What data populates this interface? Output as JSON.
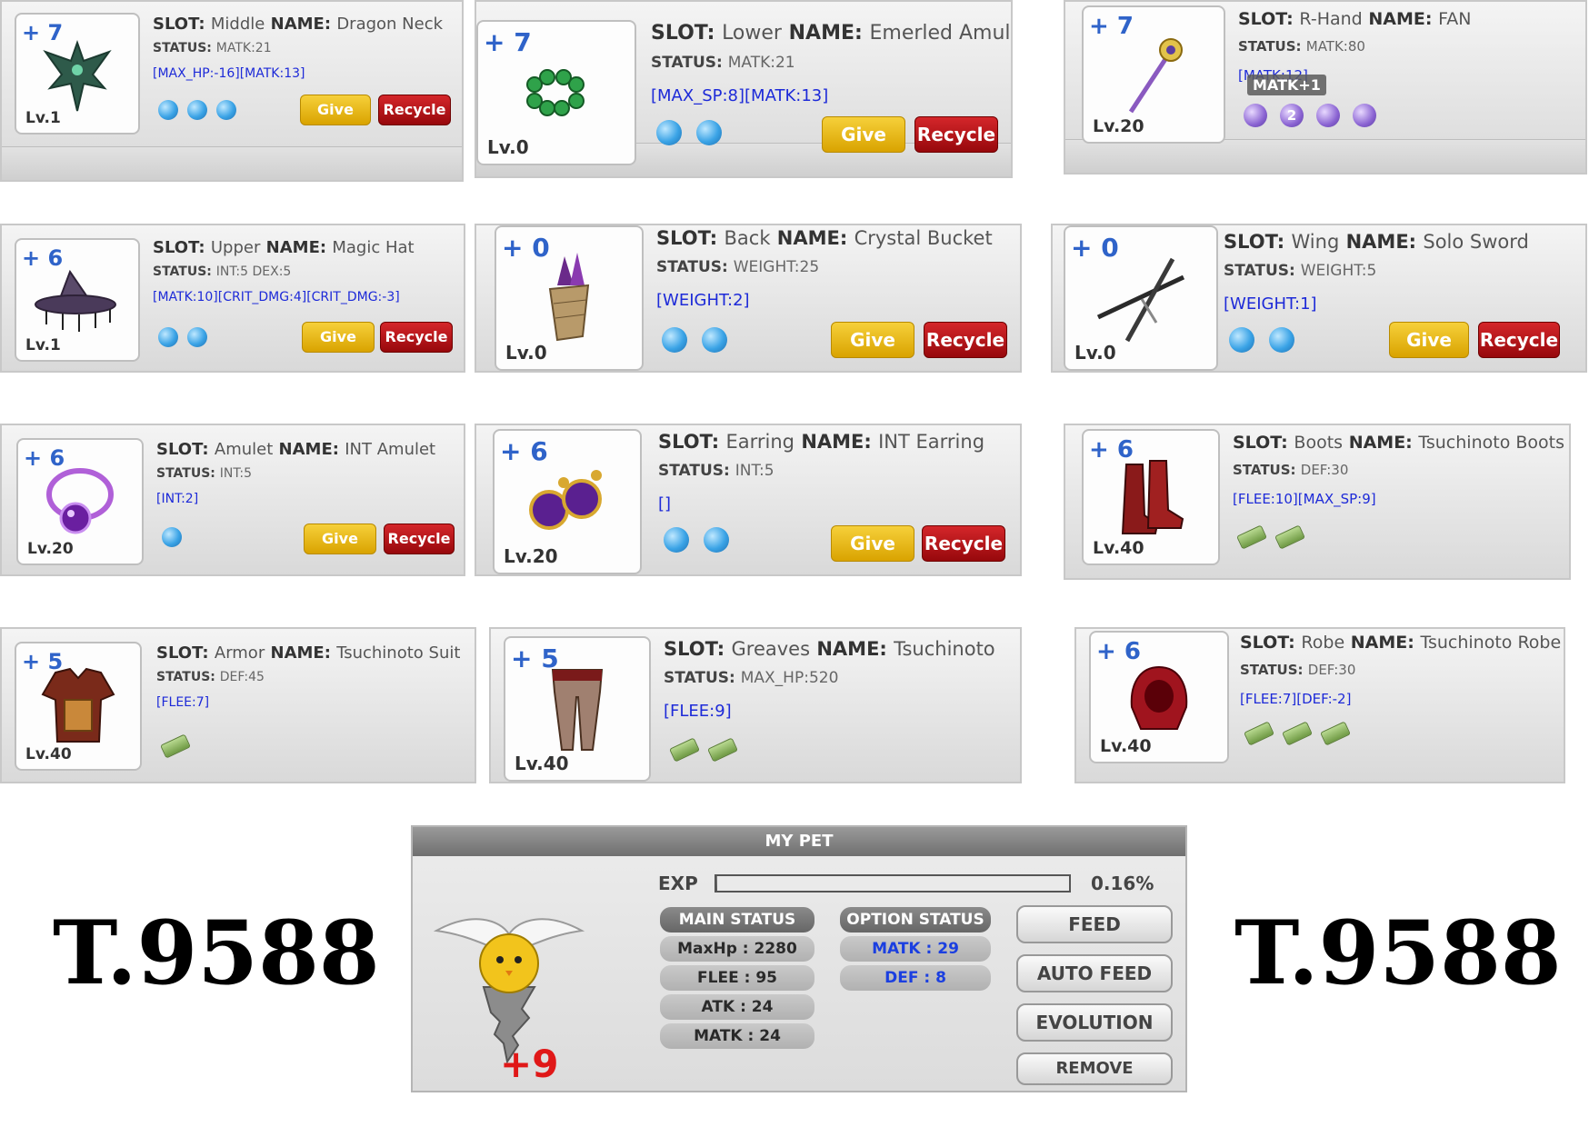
{
  "cards": [
    {
      "refine": "+ 7",
      "level": "Lv.1",
      "slot": "Middle",
      "name": "Dragon Neck",
      "status": "MATK:21",
      "options": "[MAX_HP:-16][MATK:13]",
      "give": "Give",
      "recycle": "Recycle"
    },
    {
      "refine": "+ 7",
      "level": "Lv.0",
      "slot": "Lower",
      "name": "Emerled Amulet",
      "status": "MATK:21",
      "options": "[MAX_SP:8][MATK:13]",
      "give": "Give",
      "recycle": "Recycle"
    },
    {
      "refine": "+ 7",
      "level": "Lv.20",
      "slot": "R-Hand",
      "name": "FAN",
      "status": "MATK:80",
      "options": "[MATK:12]",
      "tooltip": "MATK+1",
      "socket_number": "2"
    },
    {
      "refine": "+ 6",
      "level": "Lv.1",
      "slot": "Upper",
      "name": "Magic Hat",
      "status": "INT:5 DEX:5",
      "options": "[MATK:10][CRIT_DMG:4][CRIT_DMG:-3]",
      "give": "Give",
      "recycle": "Recycle"
    },
    {
      "refine": "+ 0",
      "level": "Lv.0",
      "slot": "Back",
      "name": "Crystal Bucket",
      "status": "WEIGHT:25",
      "options": "[WEIGHT:2]",
      "give": "Give",
      "recycle": "Recycle"
    },
    {
      "refine": "+ 0",
      "level": "Lv.0",
      "slot": "Wing",
      "name": "Solo Sword",
      "status": "WEIGHT:5",
      "options": "[WEIGHT:1]",
      "give": "Give",
      "recycle": "Recycle"
    },
    {
      "refine": "+ 6",
      "level": "Lv.20",
      "slot": "Amulet",
      "name": "INT Amulet",
      "status": "INT:5",
      "options": "[INT:2]",
      "give": "Give",
      "recycle": "Recycle"
    },
    {
      "refine": "+ 6",
      "level": "Lv.20",
      "slot": "Earring",
      "name": "INT Earring",
      "status": "INT:5",
      "options": "[]",
      "give": "Give",
      "recycle": "Recycle"
    },
    {
      "refine": "+ 6",
      "level": "Lv.40",
      "slot": "Boots",
      "name": "Tsuchinoto Boots",
      "status": "DEF:30",
      "options": "[FLEE:10][MAX_SP:9]"
    },
    {
      "refine": "+ 5",
      "level": "Lv.40",
      "slot": "Armor",
      "name": "Tsuchinoto Suit",
      "status": "DEF:45",
      "options": "[FLEE:7]"
    },
    {
      "refine": "+ 5",
      "level": "Lv.40",
      "slot": "Greaves",
      "name": "Tsuchinoto",
      "status": "MAX_HP:520",
      "options": "[FLEE:9]"
    },
    {
      "refine": "+ 6",
      "level": "Lv.40",
      "slot": "Robe",
      "name": "Tsuchinoto Robe",
      "status": "DEF:30",
      "options": "[FLEE:7][DEF:-2]"
    }
  ],
  "labels": {
    "slot": "SLOT:",
    "name": "NAME:",
    "status": "STATUS:"
  },
  "watermark": "T.9588",
  "pet": {
    "title": "MY PET",
    "exp_label": "EXP",
    "exp_value": "0.16%",
    "exp_fraction": 0.0016,
    "main_status_header": "MAIN STATUS",
    "option_status_header": "OPTION STATUS",
    "main_status": [
      "MaxHp : 2280",
      "FLEE : 95",
      "ATK : 24",
      "MATK : 24"
    ],
    "option_status": [
      "MATK : 29",
      "DEF : 8"
    ],
    "buttons": {
      "feed": "FEED",
      "auto_feed": "AUTO FEED",
      "evolution": "EVOLUTION",
      "remove": "REMOVE"
    },
    "refine": "+9"
  }
}
